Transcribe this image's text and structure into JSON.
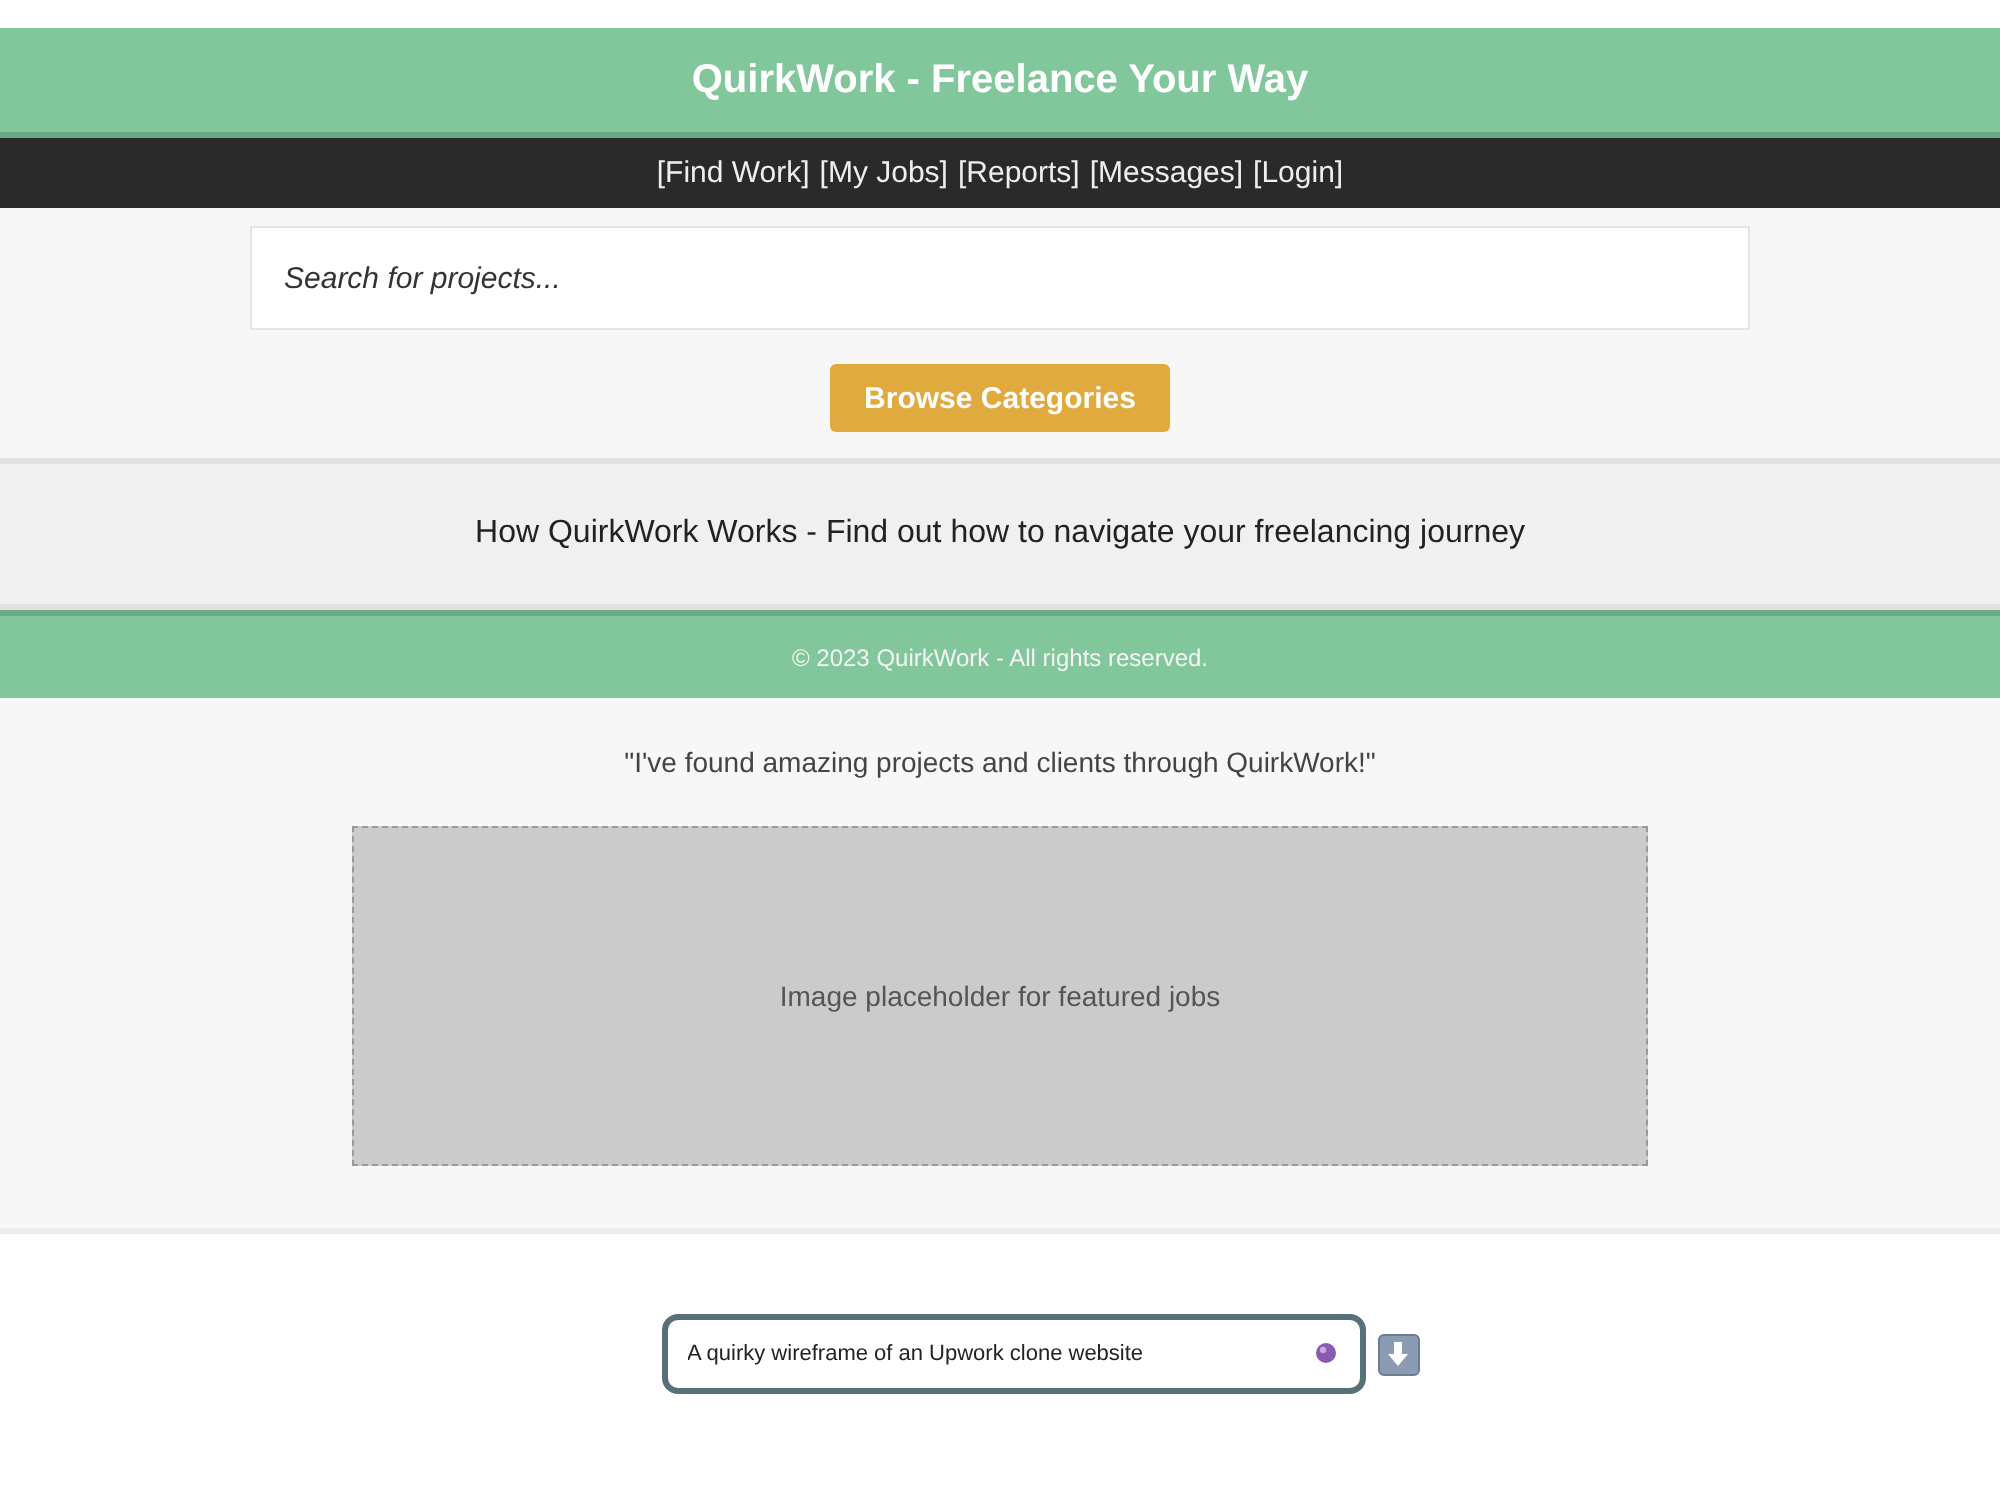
{
  "header": {
    "title": "QuirkWork - Freelance Your Way"
  },
  "nav": {
    "links": [
      "[Find Work]",
      "[My Jobs]",
      "[Reports]",
      "[Messages]",
      "[Login]"
    ]
  },
  "search": {
    "placeholder": "Search for projects..."
  },
  "browse_button": "Browse Categories",
  "how_it_works": "How QuirkWork Works - Find out how to navigate your freelancing journey",
  "footer": "© 2023 QuirkWork - All rights reserved.",
  "testimonial": "\"I've found amazing projects and clients through QuirkWork!\"",
  "featured": {
    "placeholder_text": "Image placeholder for featured jobs"
  },
  "prompt": {
    "value": "A quirky wireframe of an Upwork clone website"
  }
}
